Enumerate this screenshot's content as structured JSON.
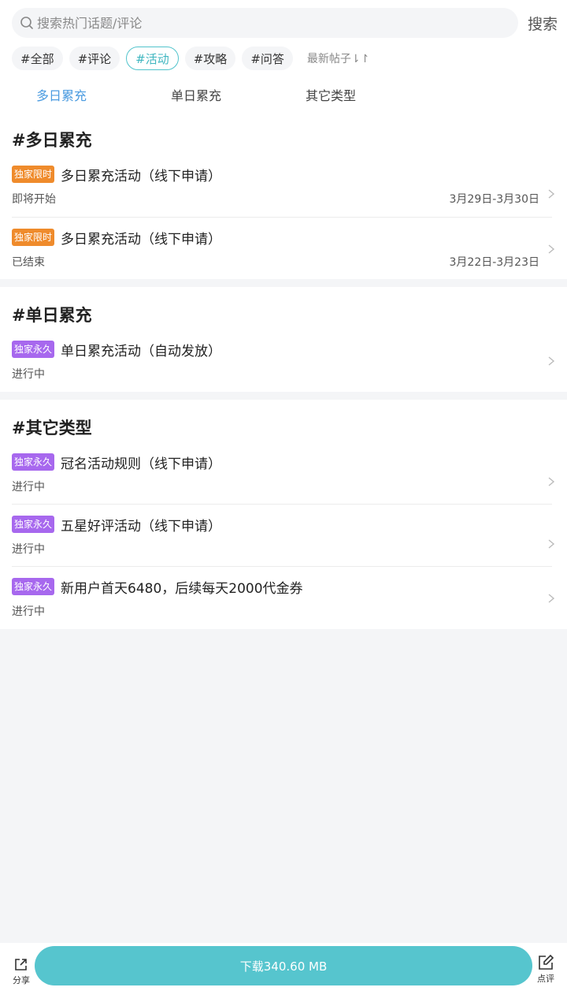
{
  "search": {
    "placeholder": "搜索热门话题/评论",
    "button": "搜索"
  },
  "tags": [
    "#全部",
    "#评论",
    "#活动",
    "#攻略",
    "#问答"
  ],
  "active_tag": "#活动",
  "sort_label": "最新帖子",
  "subtabs": [
    "多日累充",
    "单日累充",
    "其它类型"
  ],
  "sections": [
    {
      "title": "#多日累充",
      "items": [
        {
          "badge": "独家限时",
          "title": "多日累充活动（线下申请）",
          "status": "即将开始",
          "date": "3月29日-3月30日"
        },
        {
          "badge": "独家限时",
          "title": "多日累充活动（线下申请）",
          "status": "已结束",
          "date": "3月22日-3月23日"
        }
      ]
    },
    {
      "title": "#单日累充",
      "items": [
        {
          "badge": "独家永久",
          "title": "单日累充活动（自动发放）",
          "status": "进行中"
        }
      ]
    },
    {
      "title": "#其它类型",
      "items": [
        {
          "badge": "独家永久",
          "title": "冠名活动规则（线下申请）",
          "status": "进行中"
        },
        {
          "badge": "独家永久",
          "title": "五星好评活动（线下申请）",
          "status": "进行中"
        },
        {
          "badge": "独家永久",
          "title": "新用户首天6480，后续每天2000代金券",
          "status": "进行中"
        }
      ]
    }
  ],
  "bottom": {
    "share": "分享",
    "download": "下载340.60 MB",
    "review": "点评"
  },
  "colors": {
    "accent": "#56c5ce",
    "badge_limited": "#ef8b2c",
    "badge_permanent": "#a768ee",
    "active_subtab": "#4a9be0"
  }
}
